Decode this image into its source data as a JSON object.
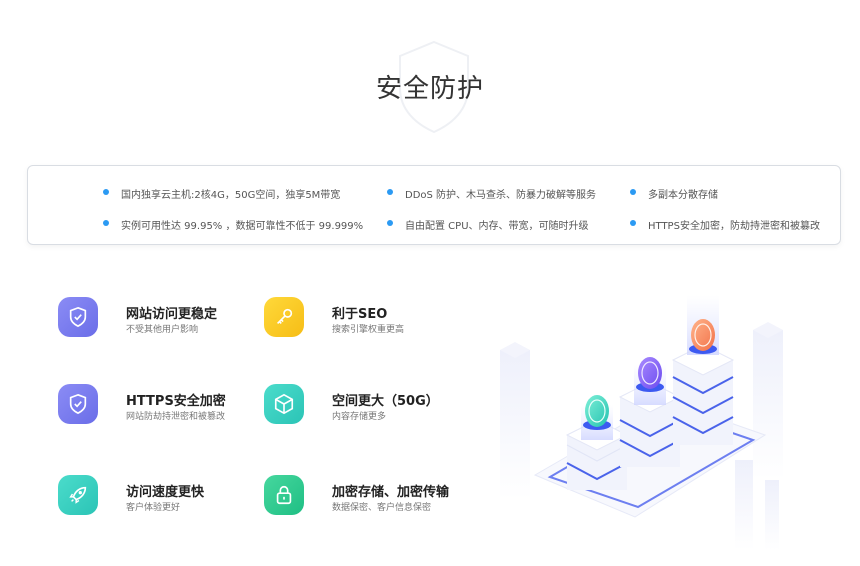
{
  "section_title": "安全防护",
  "features": [
    "国内独享云主机:2核4G，50G空间，独享5M带宽",
    "DDoS 防护、木马查杀、防暴力破解等服务",
    "多副本分散存储",
    "实例可用性达 99.95% ，数据可靠性不低于 99.999%",
    "自由配置 CPU、内存、带宽，可随时升级",
    "HTTPS安全加密，防劫持泄密和被篡改"
  ],
  "cards": [
    {
      "title": "网站访问更稳定",
      "subtitle": "不受其他用户影响",
      "icon": "shield-check-icon",
      "color": "#7b7cf0"
    },
    {
      "title": "利于SEO",
      "subtitle": "搜索引擎权重更高",
      "icon": "key-icon",
      "color": "#f8c820"
    },
    {
      "title": "HTTPS安全加密",
      "subtitle": "网站防劫持泄密和被篡改",
      "icon": "shield-check-icon",
      "color": "#7b7cf0"
    },
    {
      "title": "空间更大（50G）",
      "subtitle": "内容存储更多",
      "icon": "cube-icon",
      "color": "#35d0c0"
    },
    {
      "title": "访问速度更快",
      "subtitle": "客户体验更好",
      "icon": "rocket-icon",
      "color": "#35d0c0"
    },
    {
      "title": "加密存储、加密传输",
      "subtitle": "数据保密、客户信息保密",
      "icon": "lock-icon",
      "color": "#2dc98e"
    }
  ],
  "accent_color": "#2b9af3"
}
